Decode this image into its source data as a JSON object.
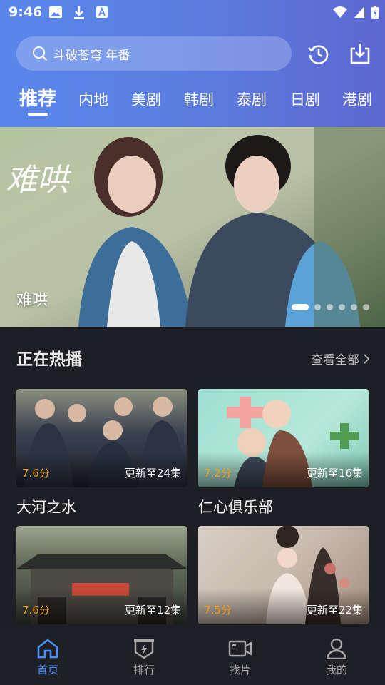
{
  "status_bar": {
    "time": "9:46"
  },
  "search": {
    "placeholder": "斗破苍穹 年番"
  },
  "tabs": [
    {
      "label": "推荐",
      "active": true
    },
    {
      "label": "内地"
    },
    {
      "label": "美剧"
    },
    {
      "label": "韩剧"
    },
    {
      "label": "泰剧"
    },
    {
      "label": "日剧"
    },
    {
      "label": "港剧"
    }
  ],
  "banner": {
    "title": "难哄",
    "art_text": "难哄",
    "slides": 6,
    "current": 1
  },
  "hot": {
    "title": "正在热播",
    "see_all": "查看全部",
    "items": [
      {
        "title": "大河之水",
        "score": "7.6分",
        "episodes": "更新至24集"
      },
      {
        "title": "仁心俱乐部",
        "score": "7.2分",
        "episodes": "更新至16集"
      },
      {
        "title": "",
        "score": "7.6分",
        "episodes": "更新至12集"
      },
      {
        "title": "",
        "score": "7.5分",
        "episodes": "更新至22集"
      }
    ]
  },
  "bottom_nav": [
    {
      "label": "首页",
      "icon": "home-icon",
      "active": true
    },
    {
      "label": "排行",
      "icon": "ranking-icon"
    },
    {
      "label": "找片",
      "icon": "video-camera-icon"
    },
    {
      "label": "我的",
      "icon": "person-icon"
    }
  ],
  "colors": {
    "accent": "#4a90ff",
    "score": "#f0a21b",
    "header_start": "#5a86ea",
    "header_end": "#5e67d2"
  }
}
